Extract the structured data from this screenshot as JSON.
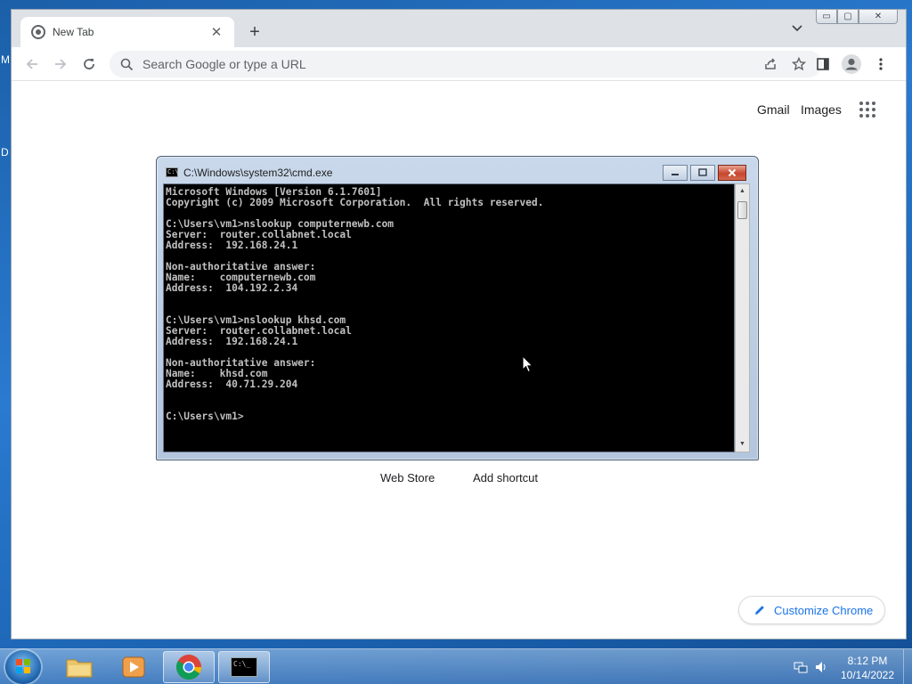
{
  "desktop": {
    "edge_letters": [
      "M",
      "D"
    ]
  },
  "browser": {
    "tab": {
      "title": "New Tab"
    },
    "omnibox": {
      "placeholder": "Search Google or type a URL"
    },
    "window_caps": {
      "minimize": "▭",
      "maximize": "▢",
      "close": "✕"
    },
    "ntp": {
      "gmail": "Gmail",
      "images": "Images",
      "shortcuts": [
        "Web Store",
        "Add shortcut"
      ],
      "customize": "Customize Chrome"
    }
  },
  "cmd": {
    "title": "C:\\Windows\\system32\\cmd.exe",
    "icon_text": "C:\\",
    "lines": [
      "Microsoft Windows [Version 6.1.7601]",
      "Copyright (c) 2009 Microsoft Corporation.  All rights reserved.",
      "",
      "C:\\Users\\vm1>nslookup computernewb.com",
      "Server:  router.collabnet.local",
      "Address:  192.168.24.1",
      "",
      "Non-authoritative answer:",
      "Name:    computernewb.com",
      "Address:  104.192.2.34",
      "",
      "",
      "C:\\Users\\vm1>nslookup khsd.com",
      "Server:  router.collabnet.local",
      "Address:  192.168.24.1",
      "",
      "Non-authoritative answer:",
      "Name:    khsd.com",
      "Address:  40.71.29.204",
      "",
      "",
      "C:\\Users\\vm1>"
    ],
    "scroll": {
      "up": "▲",
      "down": "▼"
    }
  },
  "taskbar": {
    "clock_time": "8:12 PM",
    "clock_date": "10/14/2022",
    "cmd_icon_text": "C:\\_"
  },
  "colors": {
    "console_bg": "#000000",
    "console_fg": "#c0c0c0",
    "link_blue": "#1a73e8"
  }
}
